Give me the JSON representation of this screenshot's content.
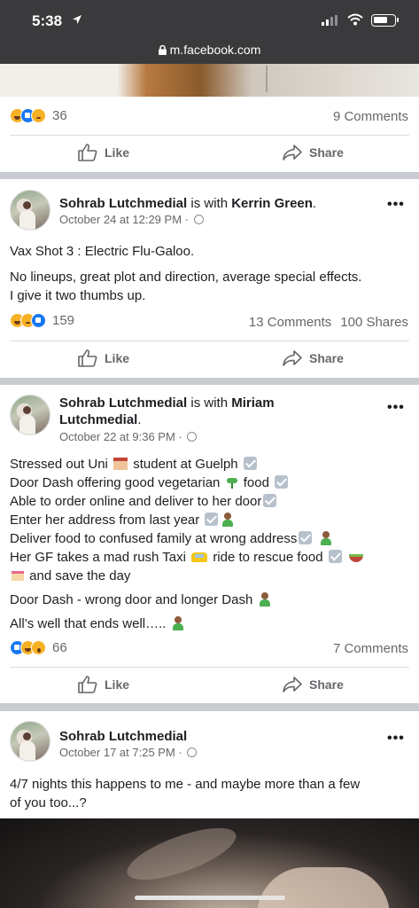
{
  "status": {
    "time": "5:38"
  },
  "browser": {
    "url": "m.facebook.com"
  },
  "posts": [
    {
      "stats": {
        "reaction_count": "36",
        "comments": "9 Comments"
      },
      "actions": {
        "like": "Like",
        "share": "Share"
      }
    },
    {
      "author": "Sohrab Lutchmedial",
      "with_text": "is with",
      "tagged": "Kerrin Green",
      "tail": ".",
      "date": "October 24 at 12:29 PM",
      "dot": "·",
      "line1": "Vax Shot 3 : Electric Flu-Galoo.",
      "line2a": "No lineups, great plot and direction, average special effects.",
      "line2b": "I give it two thumbs up.",
      "stats": {
        "reaction_count": "159",
        "comments": "13 Comments",
        "shares": "100 Shares"
      },
      "actions": {
        "like": "Like",
        "share": "Share"
      }
    },
    {
      "author": "Sohrab Lutchmedial",
      "with_text": "is with",
      "tagged_a": "Miriam",
      "tagged_b": "Lutchmedial",
      "tail": ".",
      "date": "October 22 at 9:36 PM",
      "dot": "·",
      "l1a": "Stressed out Uni",
      "l1b": "student at Guelph",
      "l2a": "Door Dash offering good vegetarian",
      "l2b": "food",
      "l3": "Able to order online and deliver to her door",
      "l4": "Enter her address from last year",
      "l5": "Deliver food to confused family at wrong address",
      "l6a": "Her GF takes a mad rush Taxi",
      "l6b": "ride to rescue food",
      "l7": "and save the day",
      "p2": "Door Dash - wrong door and longer Dash",
      "p3": "All’s well that ends well…..",
      "stats": {
        "reaction_count": "66",
        "comments": "7 Comments"
      },
      "actions": {
        "like": "Like",
        "share": "Share"
      }
    },
    {
      "author": "Sohrab Lutchmedial",
      "date": "October 17 at 7:25 PM",
      "dot": "·",
      "line1": "4/7 nights this happens to me - and maybe more than a few",
      "line2": "of you too...?"
    }
  ],
  "colors": {
    "brand": "#1877f2",
    "muted": "#65676b",
    "text": "#1c1e21"
  }
}
